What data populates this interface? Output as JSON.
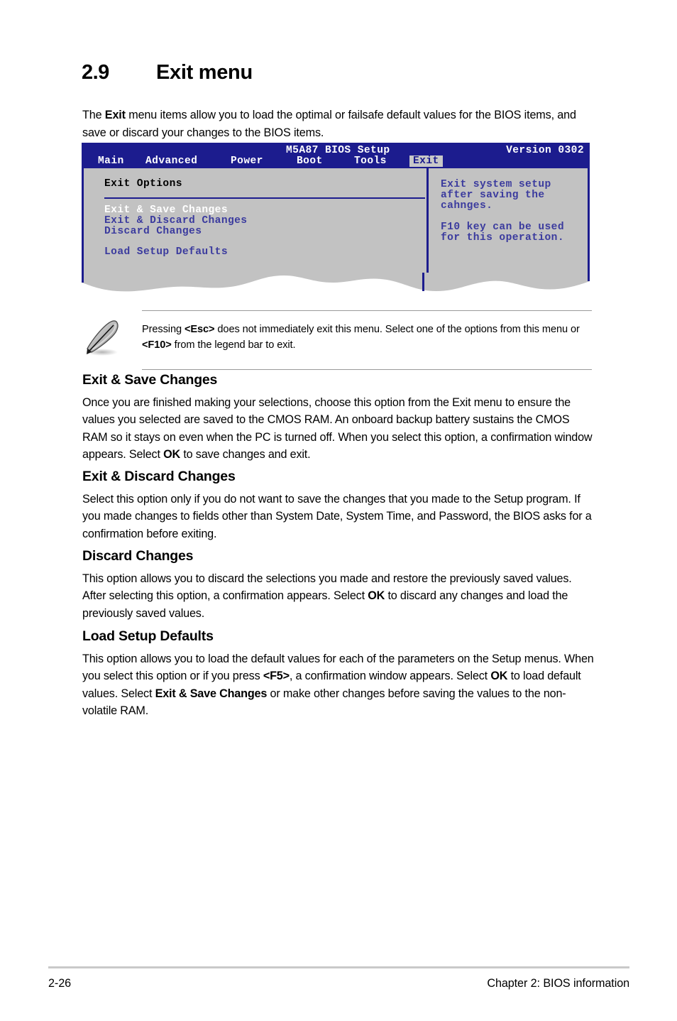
{
  "section": {
    "number": "2.9",
    "title": "Exit menu",
    "intro_pre": "The ",
    "intro_bold": "Exit",
    "intro_post": " menu items allow you to load the optimal or failsafe default values for the BIOS items, and save or discard your changes to the BIOS items."
  },
  "bios": {
    "title": "M5A87 BIOS Setup",
    "version": "Version 0302",
    "tabs": [
      {
        "label": "Main",
        "selected": false
      },
      {
        "label": "Advanced",
        "selected": false
      },
      {
        "label": "Power",
        "selected": false
      },
      {
        "label": "Boot",
        "selected": false
      },
      {
        "label": "Tools",
        "selected": false
      },
      {
        "label": "Exit",
        "selected": true
      }
    ],
    "options_title": "Exit Options",
    "items": [
      {
        "label": "Exit & Save Changes",
        "highlighted": true
      },
      {
        "label": "Exit & Discard Changes",
        "highlighted": false
      },
      {
        "label": "Discard Changes",
        "highlighted": false
      },
      {
        "label": "Load Setup Defaults",
        "highlighted": false
      }
    ],
    "help": "Exit system setup\nafter saving the\ncahnges.\n\nF10 key can be used\nfor this operation.",
    "colors": {
      "header_bg": "#1c1c8e",
      "panel_bg": "#c2c2c2",
      "text_blue": "#3b3b9e",
      "highlight_text": "#ffffff",
      "selected_tab_bg": "#c8c8c8"
    }
  },
  "note": {
    "icon": "pencil-icon",
    "part1": "Pressing ",
    "key1": "<Esc>",
    "part2": " does not immediately exit this menu. Select one of the options from this menu or ",
    "key2": "<F10>",
    "part3": " from the legend bar to exit."
  },
  "blocks": [
    {
      "heading": "Exit & Save Changes",
      "p_part1": "Once you are finished making your selections, choose this option from the Exit menu to ensure the values you selected are saved to the CMOS RAM. An onboard backup battery sustains the CMOS RAM so it stays on even when the PC is turned off. When you select this option, a confirmation window appears. Select ",
      "p_bold1": "OK",
      "p_part2": " to save changes and exit."
    },
    {
      "heading": "Exit & Discard Changes",
      "p_part1": "Select this option only if you do not want to save the changes that you made to the Setup program. If you made changes to fields other than System Date, System Time, and Password, the BIOS asks for a confirmation before exiting.",
      "p_bold1": "",
      "p_part2": ""
    },
    {
      "heading": "Discard Changes",
      "p_part1": "This option allows you to discard the selections you made and restore the previously saved values. After selecting this option, a confirmation appears. Select ",
      "p_bold1": "OK",
      "p_part2": " to discard any changes and load the previously saved values."
    },
    {
      "heading": "Load Setup Defaults",
      "p_part1": "This option allows you to load the default values for each of the parameters on the Setup menus. When you select this option or if you press ",
      "p_bold1": "<F5>",
      "p_part2": ", a confirmation window appears. Select ",
      "p_bold2": "OK",
      "p_part3": " to load default values. Select ",
      "p_bold3": "Exit & Save Changes",
      "p_part4": " or make other changes before saving the values to the non-volatile RAM."
    }
  ],
  "footer": {
    "page_number": "2-26",
    "chapter": "Chapter 2: BIOS information"
  }
}
